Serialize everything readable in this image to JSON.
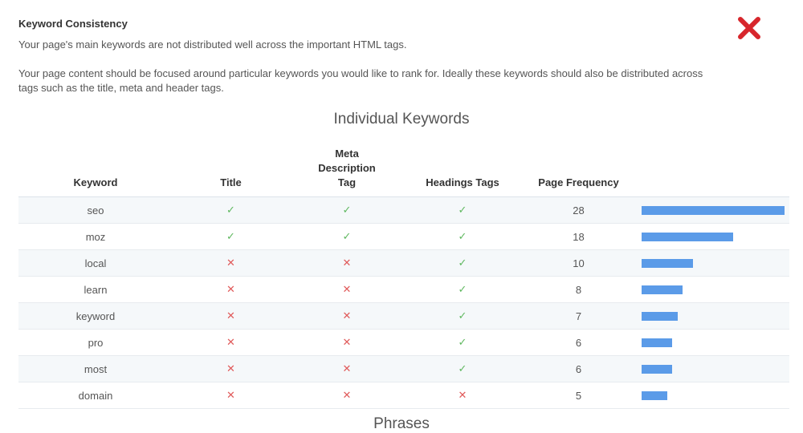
{
  "header": {
    "title": "Keyword Consistency",
    "summary": "Your page's main keywords are not distributed well across the important HTML tags.",
    "description": "Your page content should be focused around particular keywords you would like to rank for. Ideally these keywords should also be distributed across tags such as the title, meta and header tags.",
    "status_icon": "cross-icon",
    "status_color": "#d7262c"
  },
  "keywords_section": {
    "title": "Individual Keywords",
    "columns": [
      "Keyword",
      "Title",
      "Meta Description Tag",
      "Headings Tags",
      "Page Frequency"
    ],
    "rows": [
      {
        "keyword": "seo",
        "title": true,
        "meta": true,
        "headings": true,
        "frequency": "28"
      },
      {
        "keyword": "moz",
        "title": true,
        "meta": true,
        "headings": true,
        "frequency": "18"
      },
      {
        "keyword": "local",
        "title": false,
        "meta": false,
        "headings": true,
        "frequency": "10"
      },
      {
        "keyword": "learn",
        "title": false,
        "meta": false,
        "headings": true,
        "frequency": "8"
      },
      {
        "keyword": "keyword",
        "title": false,
        "meta": false,
        "headings": true,
        "frequency": "7"
      },
      {
        "keyword": "pro",
        "title": false,
        "meta": false,
        "headings": true,
        "frequency": "6"
      },
      {
        "keyword": "most",
        "title": false,
        "meta": false,
        "headings": true,
        "frequency": "6"
      },
      {
        "keyword": "domain",
        "title": false,
        "meta": false,
        "headings": false,
        "frequency": "5"
      }
    ],
    "check_symbol": "✓",
    "cross_symbol": "✕",
    "check_color": "#5fb85f",
    "cross_color": "#e05a5a",
    "bar_color": "#5b9be8"
  },
  "phrases_section": {
    "title": "Phrases"
  }
}
